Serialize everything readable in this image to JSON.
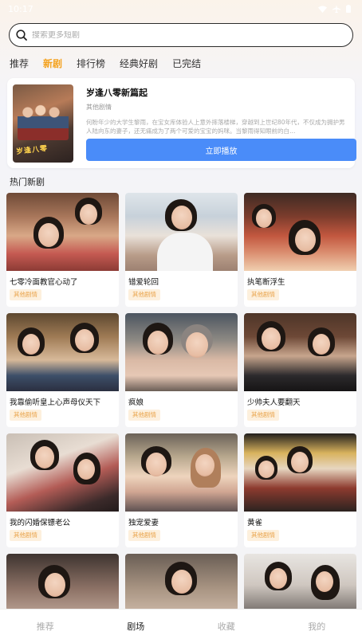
{
  "status_bar": {
    "time": "10:17"
  },
  "search": {
    "placeholder": "搜索更多短剧"
  },
  "category_tabs": [
    {
      "label": "推荐",
      "active": false
    },
    {
      "label": "新剧",
      "active": true
    },
    {
      "label": "排行榜",
      "active": false
    },
    {
      "label": "经典好剧",
      "active": false
    },
    {
      "label": "已完结",
      "active": false
    }
  ],
  "featured": {
    "title": "岁逢八零新篇起",
    "category": "其他剧情",
    "description": "何盼年少的大学生黎雨，在宝女库体验人上意外摔落楼梯，穿越到上世纪80年代，不仅成为拥护男人陆向东的妻子，还无痛成为了两个可爱的宝宝的妈咪。当黎雨得知眼前的白…",
    "poster_text": "岁逢八零",
    "play_label": "立即播放"
  },
  "section_title": "热门新剧",
  "dramas": [
    {
      "title": "七零冷面教官心动了",
      "tag": "其他剧情"
    },
    {
      "title": "错爱轮回",
      "tag": "其他剧情"
    },
    {
      "title": "执笔断浮生",
      "tag": "其他剧情"
    },
    {
      "title": "我靠偷听皇上心声母仪天下",
      "tag": "其他剧情"
    },
    {
      "title": "疯娘",
      "tag": "其他剧情"
    },
    {
      "title": "少帅夫人要翻天",
      "tag": "其他剧情"
    },
    {
      "title": "我的闪婚保镖老公",
      "tag": "其他剧情"
    },
    {
      "title": "独宠爱妻",
      "tag": "其他剧情"
    },
    {
      "title": "黄雀",
      "tag": "其他剧情"
    }
  ],
  "bottom_nav": [
    {
      "label": "推荐",
      "active": false
    },
    {
      "label": "剧场",
      "active": true
    },
    {
      "label": "收藏",
      "active": false
    },
    {
      "label": "我的",
      "active": false
    }
  ],
  "colors": {
    "accent_tab": "#f4a21e",
    "play_button": "#4a8cf9",
    "tag_bg": "#fdf0dd",
    "tag_text": "#e9a44c"
  }
}
